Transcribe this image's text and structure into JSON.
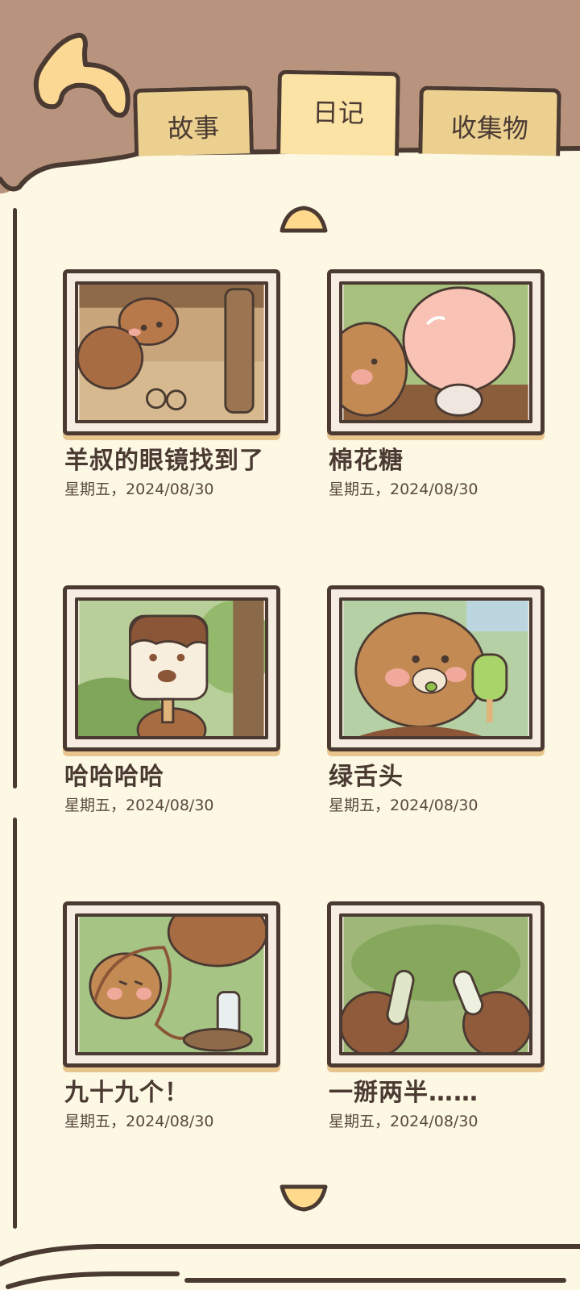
{
  "tabs": [
    {
      "label": "故事"
    },
    {
      "label": "日记",
      "active": true
    },
    {
      "label": "收集物"
    }
  ],
  "diary_entries": [
    {
      "title": "羊叔的眼镜找到了",
      "date": "星期五，2024/08/30"
    },
    {
      "title": "棉花糖",
      "date": "星期五，2024/08/30"
    },
    {
      "title": "哈哈哈哈",
      "date": "星期五，2024/08/30"
    },
    {
      "title": "绿舌头",
      "date": "星期五，2024/08/30"
    },
    {
      "title": "九十九个！",
      "date": "星期五，2024/08/30"
    },
    {
      "title": "一掰两半……",
      "date": "星期五，2024/08/30"
    }
  ],
  "icons": {
    "back": "back-arrow-icon",
    "scroll_up": "chevron-up-icon",
    "scroll_down": "chevron-down-icon"
  },
  "colors": {
    "background": "#b8937d",
    "page": "#fdf8e4",
    "outline": "#4a3a32",
    "tab": "#ecd090",
    "tab_active": "#fbe3a6",
    "accent": "#ffd98c"
  }
}
